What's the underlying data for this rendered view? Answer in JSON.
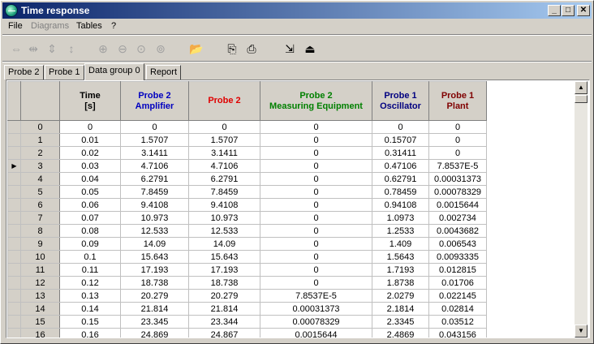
{
  "window": {
    "title": "Time response",
    "controls": {
      "minimize": "_",
      "maximize": "□",
      "close": "✕"
    }
  },
  "menu": [
    {
      "label": "File",
      "enabled": true
    },
    {
      "label": "Diagrams",
      "enabled": false
    },
    {
      "label": "Tables",
      "enabled": true
    },
    {
      "label": "?",
      "enabled": true
    }
  ],
  "toolbar": {
    "icons": [
      {
        "name": "move-left-right-icon",
        "glyph": "⇔",
        "enabled": false
      },
      {
        "name": "stretch-horizontal-icon",
        "glyph": "⇹",
        "enabled": false
      },
      {
        "name": "move-up-down-icon",
        "glyph": "⇕",
        "enabled": false
      },
      {
        "name": "stretch-vertical-icon",
        "glyph": "↕",
        "enabled": false
      },
      {
        "name": "zoom-in-icon",
        "glyph": "⊕",
        "enabled": false
      },
      {
        "name": "zoom-out-icon",
        "glyph": "⊖",
        "enabled": false
      },
      {
        "name": "zoom-fit-icon",
        "glyph": "⊙",
        "enabled": false
      },
      {
        "name": "zoom-reset-icon",
        "glyph": "⊚",
        "enabled": false
      },
      {
        "name": "open-folder-icon",
        "glyph": "📂",
        "enabled": true
      },
      {
        "name": "copy-icon",
        "glyph": "⎘",
        "enabled": true
      },
      {
        "name": "print-icon",
        "glyph": "⎙",
        "enabled": true
      },
      {
        "name": "export-icon",
        "glyph": "⇲",
        "enabled": true
      },
      {
        "name": "exit-icon",
        "glyph": "⏏",
        "enabled": true
      }
    ]
  },
  "tabs": [
    {
      "label": "Probe 2",
      "active": false
    },
    {
      "label": "Probe 1",
      "active": false
    },
    {
      "label": "Data group 0",
      "active": true
    },
    {
      "label": "Report",
      "active": false
    }
  ],
  "table": {
    "current_row_marker": "▶",
    "current_row_index": 3,
    "columns": [
      {
        "line1": "Time",
        "line2": "[s]",
        "color": "#000000"
      },
      {
        "line1": "Probe 2",
        "line2": "Amplifier",
        "color": "#0000c0"
      },
      {
        "line1": "Probe 2",
        "line2": "",
        "color": "#e00000"
      },
      {
        "line1": "Probe 2",
        "line2": "Measuring Equipment",
        "color": "#008000"
      },
      {
        "line1": "Probe 1",
        "line2": "Oscillator",
        "color": "#000080"
      },
      {
        "line1": "Probe 1",
        "line2": "Plant",
        "color": "#800000"
      }
    ],
    "rows": [
      [
        "0",
        "0",
        "0",
        "0",
        "0",
        "0",
        "0"
      ],
      [
        "1",
        "0.01",
        "1.5707",
        "1.5707",
        "0",
        "0.15707",
        "0"
      ],
      [
        "2",
        "0.02",
        "3.1411",
        "3.1411",
        "0",
        "0.31411",
        "0"
      ],
      [
        "3",
        "0.03",
        "4.7106",
        "4.7106",
        "0",
        "0.47106",
        "7.8537E-5"
      ],
      [
        "4",
        "0.04",
        "6.2791",
        "6.2791",
        "0",
        "0.62791",
        "0.00031373"
      ],
      [
        "5",
        "0.05",
        "7.8459",
        "7.8459",
        "0",
        "0.78459",
        "0.00078329"
      ],
      [
        "6",
        "0.06",
        "9.4108",
        "9.4108",
        "0",
        "0.94108",
        "0.0015644"
      ],
      [
        "7",
        "0.07",
        "10.973",
        "10.973",
        "0",
        "1.0973",
        "0.002734"
      ],
      [
        "8",
        "0.08",
        "12.533",
        "12.533",
        "0",
        "1.2533",
        "0.0043682"
      ],
      [
        "9",
        "0.09",
        "14.09",
        "14.09",
        "0",
        "1.409",
        "0.006543"
      ],
      [
        "10",
        "0.1",
        "15.643",
        "15.643",
        "0",
        "1.5643",
        "0.0093335"
      ],
      [
        "11",
        "0.11",
        "17.193",
        "17.193",
        "0",
        "1.7193",
        "0.012815"
      ],
      [
        "12",
        "0.12",
        "18.738",
        "18.738",
        "0",
        "1.8738",
        "0.01706"
      ],
      [
        "13",
        "0.13",
        "20.279",
        "20.279",
        "7.8537E-5",
        "2.0279",
        "0.022145"
      ],
      [
        "14",
        "0.14",
        "21.814",
        "21.814",
        "0.00031373",
        "2.1814",
        "0.02814"
      ],
      [
        "15",
        "0.15",
        "23.345",
        "23.344",
        "0.00078329",
        "2.3345",
        "0.03512"
      ],
      [
        "16",
        "0.16",
        "24.869",
        "24.867",
        "0.0015644",
        "2.4869",
        "0.043156"
      ]
    ]
  },
  "scrollbar": {
    "up": "▲",
    "down": "▼"
  }
}
